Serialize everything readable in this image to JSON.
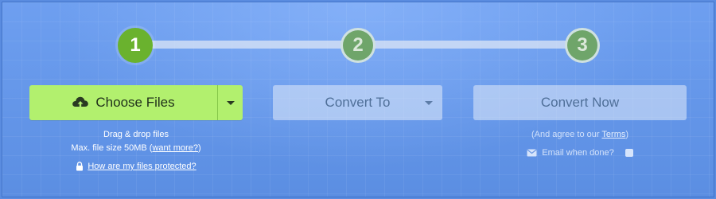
{
  "steps": [
    {
      "number": "1",
      "active": true
    },
    {
      "number": "2",
      "active": false
    },
    {
      "number": "3",
      "active": false
    }
  ],
  "choose": {
    "label": "Choose Files",
    "icon": "cloud-upload-icon",
    "drag_drop": "Drag & drop files",
    "max_size_prefix": "Max. file size 50MB (",
    "want_more": "want more?",
    "max_size_suffix": ")",
    "protected_link": "How are my files protected?"
  },
  "convert_to": {
    "label": "Convert To"
  },
  "convert_now": {
    "label": "Convert Now",
    "agree_prefix": "(And agree to our ",
    "terms": "Terms",
    "agree_suffix": ")",
    "email_label": "Email when done?"
  },
  "colors": {
    "background": "#5a8ce0",
    "choose_button": "#b2f06e",
    "active_step": "#6ab22e",
    "inactive_step": "#6fa56a"
  }
}
